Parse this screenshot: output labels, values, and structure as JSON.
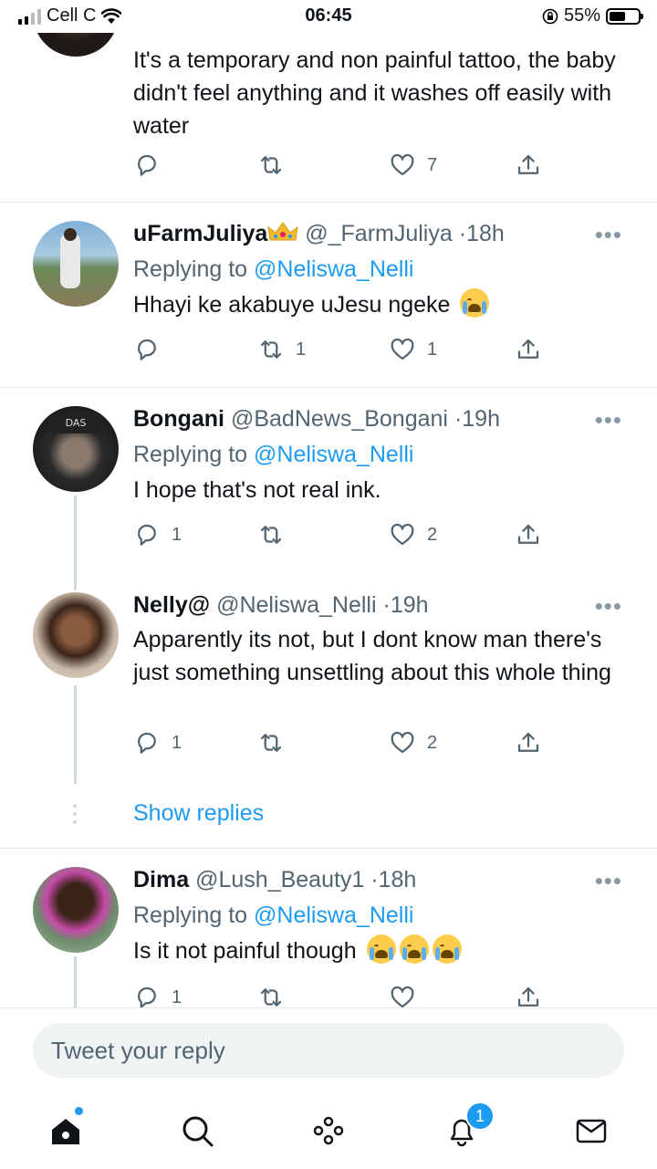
{
  "status_bar": {
    "carrier": "Cell C",
    "time": "06:45",
    "battery": "55%",
    "battery_level": 0.55
  },
  "tweets": [
    {
      "id": "top",
      "body": "It's a temporary and non painful tattoo, the baby didn't feel anything and it washes off easily with water",
      "actions": {
        "reply": "",
        "retweet": "",
        "like": "7"
      }
    },
    {
      "id": "t1",
      "name": "uFarmJuliya",
      "handle": "@_FarmJuliya",
      "time": "18h",
      "replying_prefix": "Replying to",
      "replying_to": "@Neliswa_Nelli",
      "body": "Hhayi ke akabuye uJesu ngeke",
      "actions": {
        "reply": "",
        "retweet": "1",
        "like": "1"
      }
    },
    {
      "id": "t2",
      "name": "Bongani",
      "handle": "@BadNews_Bongani",
      "time": "19h",
      "replying_prefix": "Replying to",
      "replying_to": "@Neliswa_Nelli",
      "body": "I hope that's not real ink.",
      "actions": {
        "reply": "1",
        "retweet": "",
        "like": "2"
      }
    },
    {
      "id": "t3",
      "name": "Nelly@",
      "handle": "@Neliswa_Nelli",
      "time": "19h",
      "body": "Apparently its not, but I dont know man there's just something unsettling about this whole thing",
      "actions": {
        "reply": "1",
        "retweet": "",
        "like": "2"
      }
    },
    {
      "id": "t4",
      "name": "Dima",
      "handle": "@Lush_Beauty1",
      "time": "18h",
      "replying_prefix": "Replying to",
      "replying_to": "@Neliswa_Nelli",
      "body": "Is it not painful though",
      "actions": {
        "reply": "1",
        "retweet": "",
        "like": ""
      }
    }
  ],
  "dot_separator": "·",
  "more_glyph": "•••",
  "show_replies": "Show replies",
  "composer": {
    "placeholder": "Tweet your reply"
  },
  "tabbar": {
    "notifications_badge": "1"
  },
  "colors": {
    "accent": "#1d9bf0",
    "muted": "#536471",
    "text": "#0f1419",
    "divider": "#e1e8ed"
  },
  "icons": [
    "reply-icon",
    "retweet-icon",
    "like-icon",
    "share-icon",
    "home-icon",
    "search-icon",
    "spaces-icon",
    "notifications-icon",
    "messages-icon",
    "more-icon"
  ]
}
